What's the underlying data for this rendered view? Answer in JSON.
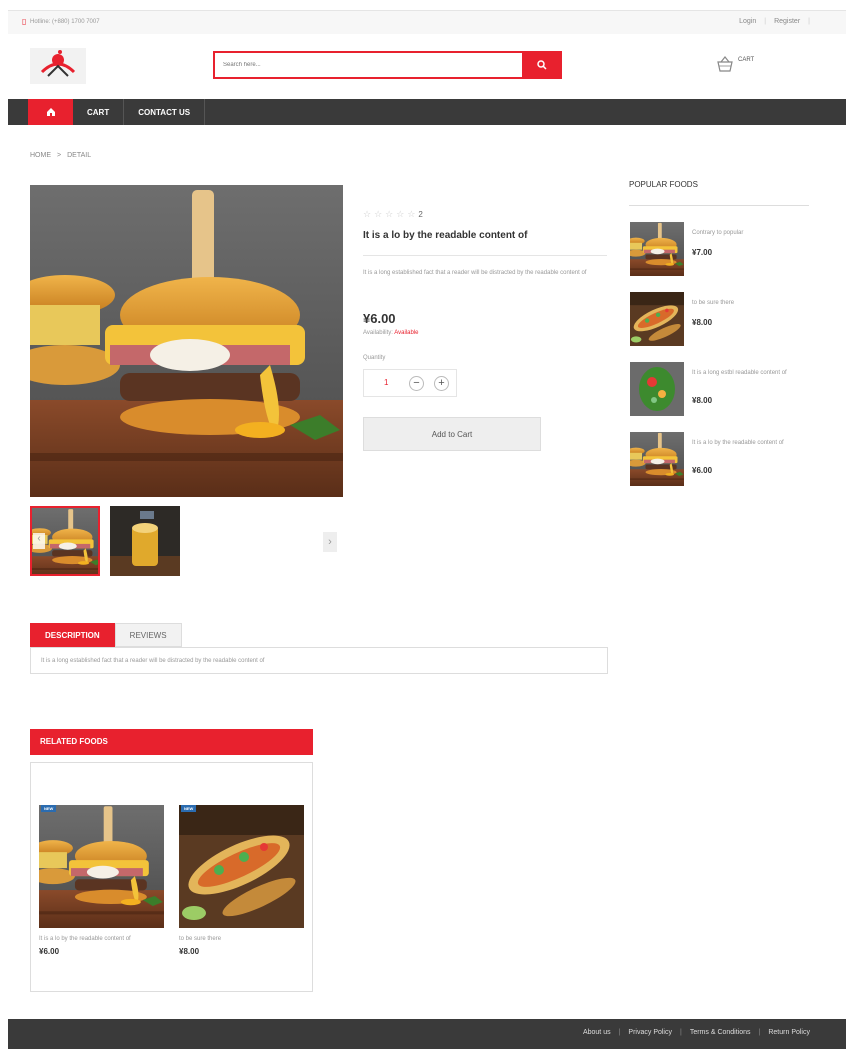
{
  "topbar": {
    "hotline": "Hotline: (+880) 1700 7007",
    "login": "Login",
    "register": "Register"
  },
  "search": {
    "placeholder": "Search here..."
  },
  "header": {
    "cart_label": "CART"
  },
  "nav": {
    "items": [
      "CART",
      "CONTACT US"
    ]
  },
  "breadcrumb": {
    "home": "HOME",
    "sep": ">",
    "current": "DETAIL"
  },
  "product": {
    "rating_count": "2",
    "title": "It is a lo by the readable content of",
    "description": "It is a long established fact that a reader will be distracted by the readable content of",
    "price": "¥6.00",
    "availability_label": "Availability:",
    "availability_value": "Available",
    "quantity_label": "Quantity",
    "quantity_value": "1",
    "add_to_cart": "Add to Cart"
  },
  "popular": {
    "title": "POPULAR FOODS",
    "items": [
      {
        "name": "Contrary to popular",
        "price": "¥7.00"
      },
      {
        "name": "to be sure there",
        "price": "¥8.00"
      },
      {
        "name": "It is a long estbl readable content of",
        "price": "¥8.00"
      },
      {
        "name": "It is a lo by the readable content of",
        "price": "¥6.00"
      }
    ]
  },
  "tabs": {
    "description": "DESCRIPTION",
    "reviews": "REVIEWS",
    "content": "It is a long established fact that a reader will be distracted by the readable content of"
  },
  "related": {
    "title": "RELATED FOODS",
    "items": [
      {
        "badge": "NEW",
        "name": "It is a lo by the readable content of",
        "price": "¥6.00"
      },
      {
        "badge": "NEW",
        "name": "to be sure there",
        "price": "¥8.00"
      }
    ]
  },
  "footer": {
    "links": [
      "About us",
      "Privacy Policy",
      "Terms & Conditions",
      "Return Policy"
    ]
  },
  "colors": {
    "accent": "#e8212e",
    "nav_bg": "#3a3a3a"
  }
}
